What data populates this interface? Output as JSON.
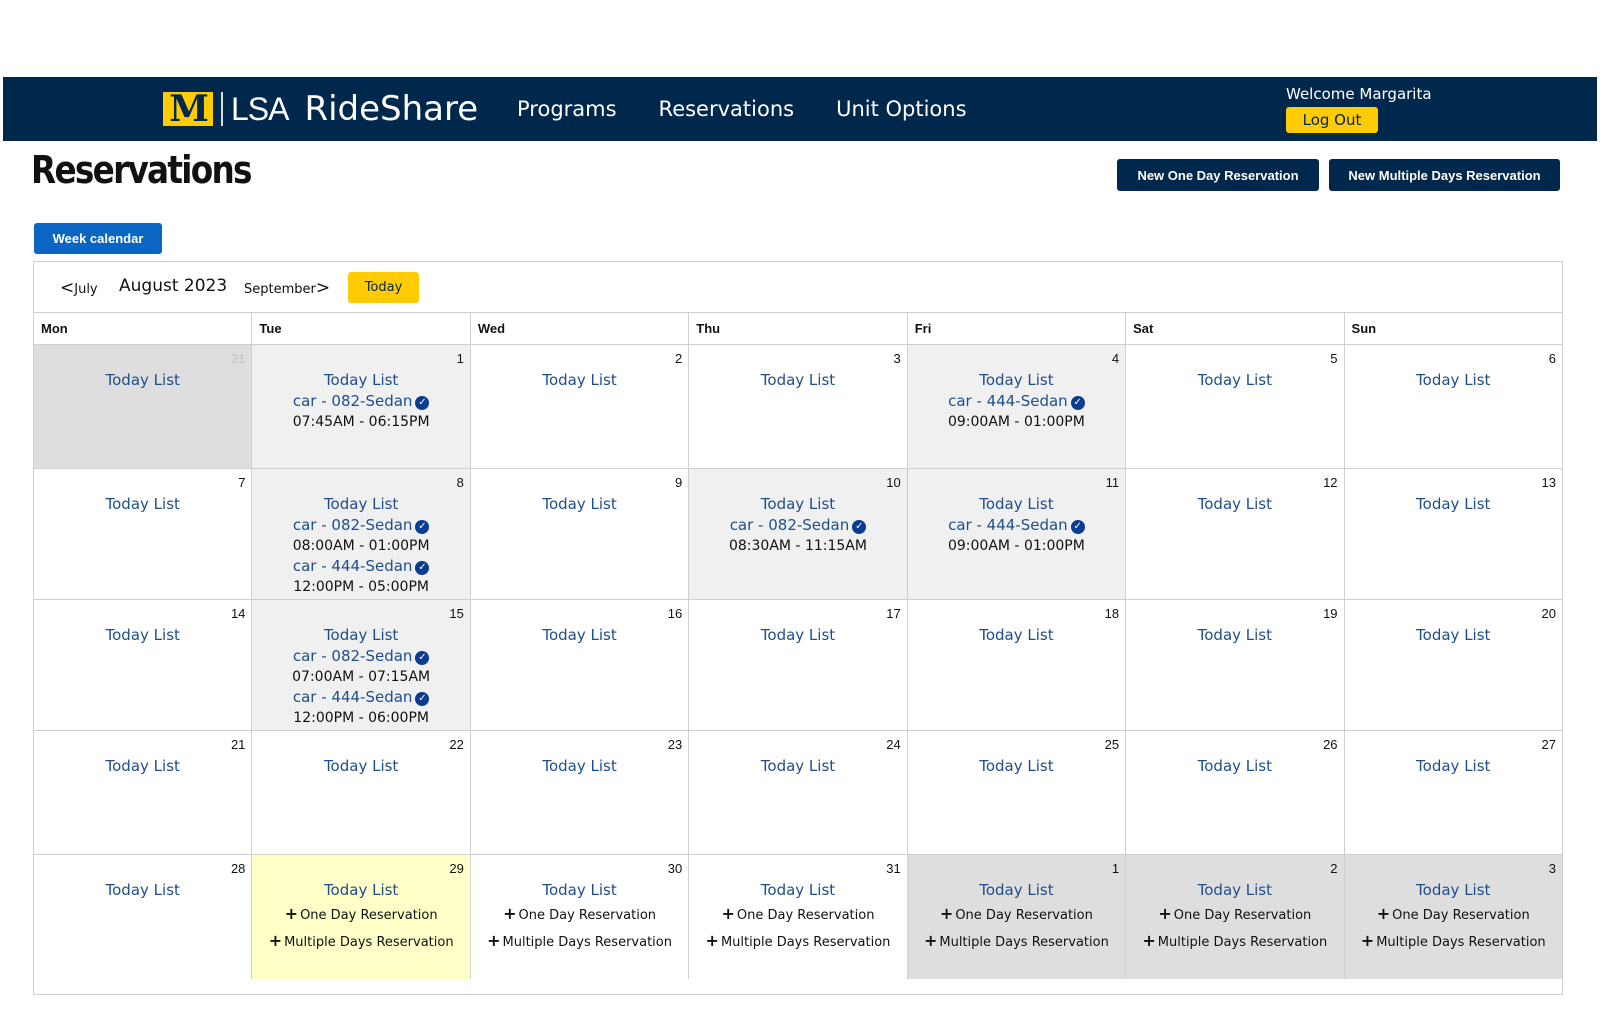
{
  "header": {
    "brand_lsa": "LSA",
    "brand_name": "RideShare",
    "nav": [
      "Programs",
      "Reservations",
      "Unit Options"
    ],
    "welcome": "Welcome Margarita",
    "logout": "Log Out"
  },
  "page": {
    "title": "Reservations",
    "new_one_day": "New One Day Reservation",
    "new_multi_days": "New Multiple Days Reservation",
    "week_calendar": "Week calendar"
  },
  "calendar": {
    "prev_label": "July",
    "next_label": "September",
    "month_title": "August 2023",
    "today_button": "Today",
    "weekdays": [
      "Mon",
      "Tue",
      "Wed",
      "Thu",
      "Fri",
      "Sat",
      "Sun"
    ],
    "today_list_label": "Today List",
    "add_one_day_label": "One Day Reservation",
    "add_multi_days_label": "Multiple Days Reservation",
    "weeks": [
      [
        {
          "day": "31",
          "state": "outside-faded",
          "reservations": []
        },
        {
          "day": "1",
          "state": "res",
          "reservations": [
            {
              "car": "car - 082-Sedan",
              "time": "07:45AM - 06:15PM"
            }
          ]
        },
        {
          "day": "2",
          "state": "normal",
          "reservations": []
        },
        {
          "day": "3",
          "state": "normal",
          "reservations": []
        },
        {
          "day": "4",
          "state": "res",
          "reservations": [
            {
              "car": "car - 444-Sedan",
              "time": "09:00AM - 01:00PM"
            }
          ]
        },
        {
          "day": "5",
          "state": "normal",
          "reservations": []
        },
        {
          "day": "6",
          "state": "normal",
          "reservations": []
        }
      ],
      [
        {
          "day": "7",
          "state": "normal",
          "reservations": []
        },
        {
          "day": "8",
          "state": "res",
          "reservations": [
            {
              "car": "car - 082-Sedan",
              "time": "08:00AM - 01:00PM"
            },
            {
              "car": "car - 444-Sedan",
              "time": "12:00PM - 05:00PM"
            }
          ]
        },
        {
          "day": "9",
          "state": "normal",
          "reservations": []
        },
        {
          "day": "10",
          "state": "res",
          "reservations": [
            {
              "car": "car - 082-Sedan",
              "time": "08:30AM - 11:15AM"
            }
          ]
        },
        {
          "day": "11",
          "state": "res",
          "reservations": [
            {
              "car": "car - 444-Sedan",
              "time": "09:00AM - 01:00PM"
            }
          ]
        },
        {
          "day": "12",
          "state": "normal",
          "reservations": []
        },
        {
          "day": "13",
          "state": "normal",
          "reservations": []
        }
      ],
      [
        {
          "day": "14",
          "state": "normal",
          "reservations": []
        },
        {
          "day": "15",
          "state": "res",
          "reservations": [
            {
              "car": "car - 082-Sedan",
              "time": "07:00AM - 07:15AM"
            },
            {
              "car": "car - 444-Sedan",
              "time": "12:00PM - 06:00PM"
            }
          ]
        },
        {
          "day": "16",
          "state": "normal",
          "reservations": []
        },
        {
          "day": "17",
          "state": "normal",
          "reservations": []
        },
        {
          "day": "18",
          "state": "normal",
          "reservations": []
        },
        {
          "day": "19",
          "state": "normal",
          "reservations": []
        },
        {
          "day": "20",
          "state": "normal",
          "reservations": []
        }
      ],
      [
        {
          "day": "21",
          "state": "normal",
          "reservations": []
        },
        {
          "day": "22",
          "state": "normal",
          "reservations": []
        },
        {
          "day": "23",
          "state": "normal",
          "reservations": []
        },
        {
          "day": "24",
          "state": "normal",
          "reservations": []
        },
        {
          "day": "25",
          "state": "normal",
          "reservations": []
        },
        {
          "day": "26",
          "state": "normal",
          "reservations": []
        },
        {
          "day": "27",
          "state": "normal",
          "reservations": []
        }
      ],
      [
        {
          "day": "28",
          "state": "normal",
          "reservations": []
        },
        {
          "day": "29",
          "state": "today",
          "add": true,
          "reservations": []
        },
        {
          "day": "30",
          "state": "normal",
          "add": true,
          "reservations": []
        },
        {
          "day": "31",
          "state": "normal",
          "add": true,
          "reservations": []
        },
        {
          "day": "1",
          "state": "outside",
          "add": true,
          "reservations": []
        },
        {
          "day": "2",
          "state": "outside",
          "add": true,
          "reservations": []
        },
        {
          "day": "3",
          "state": "outside",
          "add": true,
          "reservations": []
        }
      ]
    ]
  },
  "colors": {
    "navy": "#00274c",
    "maize": "#ffcb05",
    "link_blue": "#1f4e8c",
    "button_blue": "#0a66c2",
    "reserved_bg": "#f0f0f0",
    "outside_bg": "#dedede",
    "today_bg": "#ffffc7"
  }
}
